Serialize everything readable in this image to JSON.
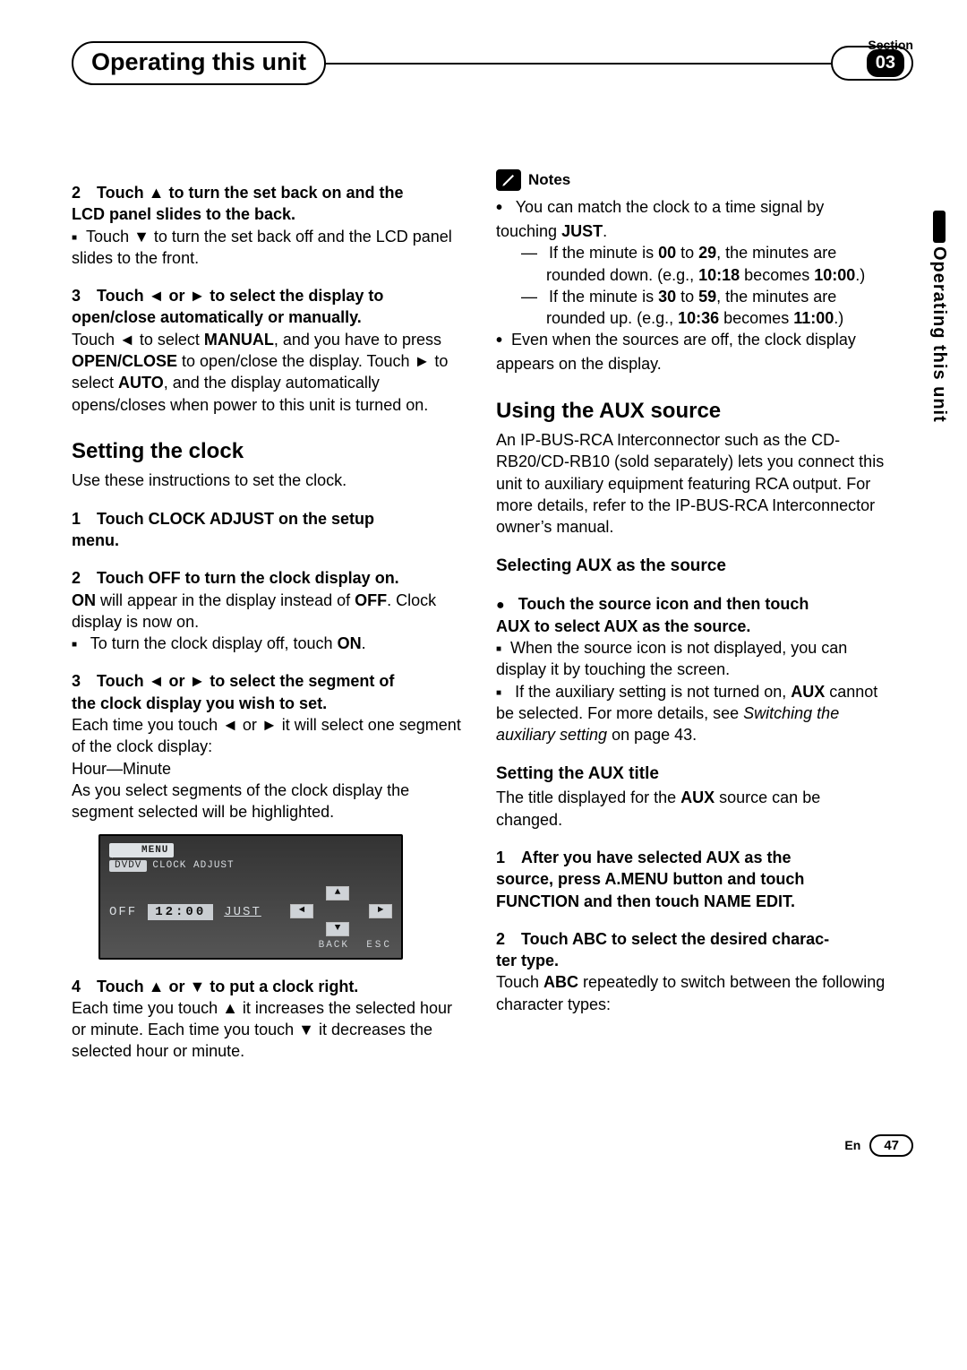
{
  "header": {
    "section_label": "Section",
    "title": "Operating this unit",
    "number": "03",
    "side_tab": "Operating this unit"
  },
  "left": {
    "s2_head_a": "2 Touch ▲ to turn the set back on and the",
    "s2_head_b": "LCD panel slides to the back.",
    "s2_b1": "Touch ▼ to turn the set back off and the LCD panel slides to the front.",
    "s3_head_a": "3 Touch ◄ or ► to select the display to",
    "s3_head_b": "open/close automatically or manually.",
    "s3_body1a": "Touch ◄ to select ",
    "s3_body1b": "MANUAL",
    "s3_body1c": ", and you have to press ",
    "s3_body1d": "OPEN/CLOSE",
    "s3_body1e": " to open/close the display. Touch ► to select ",
    "s3_body1f": "AUTO",
    "s3_body1g": ", and the display automatically opens/closes when power to this unit is turned on.",
    "clock_h2": "Setting the clock",
    "clock_intro": "Use these instructions to set the clock.",
    "c1_a": "1 Touch CLOCK ADJUST on the setup",
    "c1_b": "menu.",
    "c2_head": "2 Touch OFF to turn the clock display on.",
    "c2_b_a": "ON",
    "c2_b_b": " will appear in the display instead of ",
    "c2_b_c": "OFF",
    "c2_b_d": ". Clock display is now on.",
    "c2_bul_a": "To turn the clock display off, touch ",
    "c2_bul_b": "ON",
    "c2_bul_c": ".",
    "c3_a": "3 Touch ◄ or ► to select the segment of",
    "c3_b": "the clock display you wish to set.",
    "c3_body": "Each time you touch ◄ or ► it will select one segment of the clock display:",
    "c3_hm": "Hour—Minute",
    "c3_body2": "As you select segments of the clock display the segment selected will be highlighted.",
    "ss": {
      "menu": "MENU",
      "dvdv": "DVDV",
      "clockadj": "CLOCK ADJUST",
      "off": "OFF",
      "time": "12:00",
      "just": "JUST",
      "back": "BACK",
      "esc": "ESC"
    },
    "c4_head": "4 Touch ▲ or ▼ to put a clock right.",
    "c4_body": "Each time you touch ▲ it increases the selected hour or minute. Each time you touch ▼ it decreases the selected hour or minute."
  },
  "right": {
    "notes_label": "Notes",
    "n1_a": "You can match the clock to a time signal by touching ",
    "n1_b": "JUST",
    "n1_c": ".",
    "n1d1_a": "If the minute is ",
    "n1d1_b": "00",
    "n1d1_c": " to ",
    "n1d1_d": "29",
    "n1d1_e": ", the minutes are rounded down. (e.g., ",
    "n1d1_f": "10:18",
    "n1d1_g": " becomes ",
    "n1d1_h": "10:00",
    "n1d1_i": ".)",
    "n1d2_a": "If the minute is ",
    "n1d2_b": "30",
    "n1d2_c": " to ",
    "n1d2_d": "59",
    "n1d2_e": ", the minutes are rounded up. (e.g., ",
    "n1d2_f": "10:36",
    "n1d2_g": " becomes ",
    "n1d2_h": "11:00",
    "n1d2_i": ".)",
    "n2": "Even when the sources are off, the clock display appears on the display.",
    "aux_h2": "Using the AUX source",
    "aux_intro": "An IP-BUS-RCA Interconnector such as the CD-RB20/CD-RB10 (sold separately) lets you connect this unit to auxiliary equipment featuring RCA output. For more details, refer to the IP-BUS-RCA Interconnector owner’s manual.",
    "sel_h3": "Selecting AUX as the source",
    "sel_step_a": "Touch the source icon and then touch",
    "sel_step_b": "AUX to select AUX as the source.",
    "sel_b1": "When the source icon is not displayed, you can display it by touching the screen.",
    "sel_b2_a": "If the auxiliary setting is not turned on, ",
    "sel_b2_b": "AUX",
    "sel_b2_c": " cannot be selected. For more details, see ",
    "sel_b2_d": "Switching the auxiliary setting",
    "sel_b2_e": " on page 43.",
    "title_h3": "Setting the AUX title",
    "title_intro_a": "The title displayed for the ",
    "title_intro_b": "AUX",
    "title_intro_c": " source can be changed.",
    "t1_a": "1 After you have selected AUX as the",
    "t1_b": "source, press A.MENU button and touch",
    "t1_c": "FUNCTION and then touch NAME EDIT.",
    "t2_a": "2 Touch ABC to select the desired charac-",
    "t2_b": "ter type.",
    "t2_body_a": "Touch ",
    "t2_body_b": "ABC",
    "t2_body_c": " repeatedly to switch between the following character types:"
  },
  "footer": {
    "lang": "En",
    "page": "47"
  }
}
